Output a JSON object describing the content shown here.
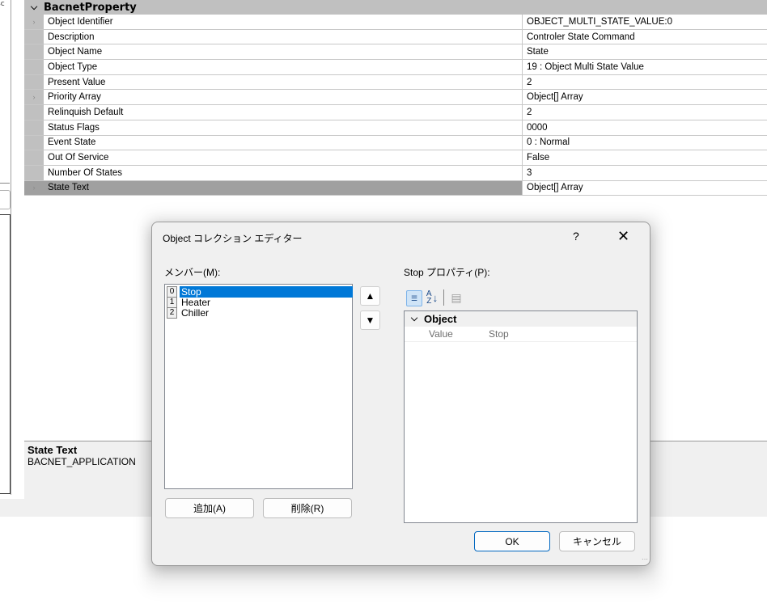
{
  "left_panel": {
    "tab_fragment": "sc"
  },
  "grid": {
    "category": "BacnetProperty",
    "rows": [
      {
        "name": "Object Identifier",
        "value": "OBJECT_MULTI_STATE_VALUE:0",
        "expandable": true
      },
      {
        "name": "Description",
        "value": "Controler State Command",
        "expandable": false
      },
      {
        "name": "Object Name",
        "value": "State",
        "expandable": false
      },
      {
        "name": "Object Type",
        "value": "19 : Object Multi State Value",
        "expandable": false
      },
      {
        "name": "Present Value",
        "value": "2",
        "expandable": false
      },
      {
        "name": "Priority Array",
        "value": "Object[] Array",
        "expandable": true
      },
      {
        "name": "Relinquish Default",
        "value": "2",
        "expandable": false
      },
      {
        "name": "Status Flags",
        "value": "0000",
        "expandable": false
      },
      {
        "name": "Event State",
        "value": "0 : Normal",
        "expandable": false
      },
      {
        "name": "Out Of Service",
        "value": "False",
        "expandable": false
      },
      {
        "name": "Number Of States",
        "value": "3",
        "expandable": false
      },
      {
        "name": "State Text",
        "value": "Object[] Array",
        "expandable": true,
        "selected": true
      }
    ]
  },
  "description_panel": {
    "title": "State Text",
    "text": "BACNET_APPLICATION"
  },
  "dialog": {
    "title": "Object コレクション エディター",
    "help": "?",
    "close": "✕",
    "members_label": "メンバー(M):",
    "members": [
      {
        "index": "0",
        "label": "Stop",
        "selected": true
      },
      {
        "index": "1",
        "label": "Heater",
        "selected": false
      },
      {
        "index": "2",
        "label": "Chiller",
        "selected": false
      }
    ],
    "move_up": "🡅",
    "move_down": "🡇",
    "add_button": "追加(A)",
    "remove_button": "削除(R)",
    "properties_label": "Stop プロパティ(P):",
    "toolbar": {
      "categorized_icon": "categorized-icon",
      "alphabetical_icon": "sort-alpha-icon",
      "property_pages_icon": "property-pages-icon"
    },
    "property_category": "Object",
    "properties": [
      {
        "name": "Value",
        "value": "Stop"
      }
    ],
    "ok_button": "OK",
    "cancel_button": "キャンセル"
  },
  "colors": {
    "selection": "#0078d7",
    "grid_gutter": "#c0c0c0",
    "dialog_bg": "#f0f0f0"
  }
}
